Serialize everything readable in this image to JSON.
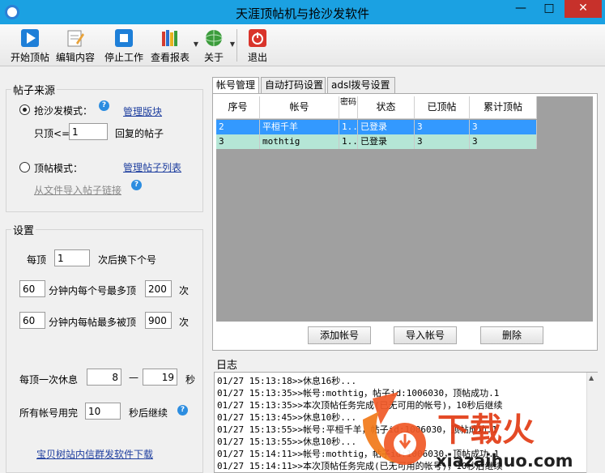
{
  "window": {
    "title": "天涯顶帖机与抢沙发软件",
    "min": "—",
    "max": "□",
    "close": "✕"
  },
  "toolbar": {
    "start": "开始顶帖",
    "edit": "编辑内容",
    "stop": "停止工作",
    "report": "查看报表",
    "about": "关于",
    "exit": "退出"
  },
  "source": {
    "title": "帖子来源",
    "sofa_mode": "抢沙发模式：",
    "manage_boards": "管理版块",
    "only_top_prefix": "只顶<=",
    "only_top_value": "1",
    "only_top_suffix": "回复的帖子",
    "top_mode": "顶帖模式：",
    "manage_posts": "管理帖子列表",
    "import_links": "从文件导入帖子链接",
    "help": "?"
  },
  "settings": {
    "title": "设置",
    "each_top": "每顶",
    "switch_count": "1",
    "switch_suffix": "次后换下个号",
    "minutes1": "60",
    "per_account_max": "分钟内每个号最多顶",
    "per_account_value": "200",
    "times": "次",
    "minutes2": "60",
    "per_post_max": "分钟内每帖最多被顶",
    "per_post_value": "900",
    "times2": "次",
    "rest_label": "每顶一次休息",
    "rest_min": "8",
    "dash": "—",
    "rest_max": "19",
    "seconds": "秒",
    "all_used": "所有帐号用完",
    "continue_after": "10",
    "continue_suffix": "秒后继续",
    "promo_link": "宝贝树站内信群发软件下载"
  },
  "tabs": [
    "帐号管理",
    "自动打码设置",
    "adsl拨号设置"
  ],
  "accounts": {
    "columns": [
      "序号",
      "帐号",
      "密码",
      "状态",
      "已顶帖",
      "累计顶帖"
    ],
    "rows": [
      {
        "no": "2",
        "account": "平桓千羊",
        "password": "1..",
        "status": "已登录",
        "done": "3",
        "total": "3",
        "selected": true
      },
      {
        "no": "3",
        "account": "mothtig",
        "password": "1..",
        "status": "已登录",
        "done": "3",
        "total": "3",
        "selected": false
      }
    ],
    "add_btn": "添加帐号",
    "import_btn": "导入帐号",
    "delete_btn": "删除"
  },
  "log": {
    "title": "日志",
    "lines": [
      "01/27 15:13:18>>休息16秒...",
      "01/27 15:13:35>>帐号:mothtig，帖子id:1006030，顶帖成功.1",
      "01/27 15:13:35>>本次顶帖任务完成(已无可用的帐号)，10秒后继续",
      "01/27 15:13:45>>休息10秒...",
      "01/27 15:13:55>>帐号:平桓千羊，帖子id:1006030，顶帖成功.1",
      "01/27 15:13:55>>休息10秒...",
      "01/27 15:14:11>>帐号:mothtig，帖子id:1006030，顶帖成功.1",
      "01/27 15:14:11>>本次顶帖任务完成(已无可用的帐号)，10秒后继续"
    ]
  },
  "watermark": {
    "brand": "下载火",
    "site": "xiazaihuo.com"
  },
  "colors": {
    "titlebar": "#1ba1e2",
    "selected_row": "#3399ff",
    "second_row": "#b5e6d6",
    "link": "#1f3f9f"
  }
}
